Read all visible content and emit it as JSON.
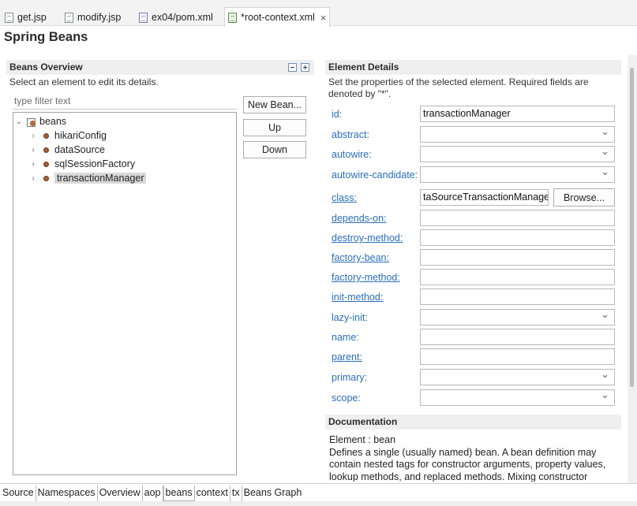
{
  "editor_tabs": [
    {
      "label": "get.jsp",
      "icon": "jsp-file-icon"
    },
    {
      "label": "modify.jsp",
      "icon": "jsp-file-icon"
    },
    {
      "label": "ex04/pom.xml",
      "icon": "xml-file-icon"
    },
    {
      "label": "*root-context.xml",
      "icon": "spring-config-file-icon",
      "active": true,
      "close": "×"
    }
  ],
  "page_title": "Spring Beans",
  "beans_overview": {
    "title": "Beans Overview",
    "description": "Select an element to edit its details.",
    "filter_placeholder": "type filter text",
    "tree": {
      "root": "beans",
      "children": [
        "hikariConfig",
        "dataSource",
        "sqlSessionFactory",
        "transactionManager"
      ],
      "selected": "transactionManager"
    },
    "buttons": {
      "new_bean": "New Bean...",
      "up": "Up",
      "down": "Down"
    }
  },
  "element_details": {
    "title": "Element Details",
    "description": "Set the properties of the selected element. Required fields are denoted by \"*\".",
    "fields": [
      {
        "label": "id:",
        "value": "transactionManager",
        "type": "text",
        "link": false
      },
      {
        "label": "abstract:",
        "value": "",
        "type": "combo",
        "link": false
      },
      {
        "label": "autowire:",
        "value": "",
        "type": "combo",
        "link": false
      },
      {
        "label": "autowire-candidate:",
        "value": "",
        "type": "combo",
        "link": false
      },
      {
        "label": "class:",
        "value": "taSourceTransactionManager",
        "type": "text",
        "link": true
      },
      {
        "label": "depends-on:",
        "value": "",
        "type": "text",
        "link": true
      },
      {
        "label": "destroy-method:",
        "value": "",
        "type": "text",
        "link": true
      },
      {
        "label": "factory-bean:",
        "value": "",
        "type": "text",
        "link": true
      },
      {
        "label": "factory-method:",
        "value": "",
        "type": "text",
        "link": true
      },
      {
        "label": "init-method:",
        "value": "",
        "type": "text",
        "link": true
      },
      {
        "label": "lazy-init:",
        "value": "",
        "type": "combo",
        "link": false
      },
      {
        "label": "name:",
        "value": "",
        "type": "text",
        "link": false
      },
      {
        "label": "parent:",
        "value": "",
        "type": "text",
        "link": true
      },
      {
        "label": "primary:",
        "value": "",
        "type": "combo",
        "link": false
      },
      {
        "label": "scope:",
        "value": "",
        "type": "combo",
        "link": false
      }
    ],
    "browse_label": "Browse..."
  },
  "documentation": {
    "title": "Documentation",
    "text": "Element : bean\nDefines a single (usually named) bean. A bean definition may contain nested tags for constructor arguments, property values, lookup methods, and replaced methods. Mixing constructor"
  },
  "bottom_tabs": [
    "Source",
    "Namespaces",
    "Overview",
    "aop",
    "beans",
    "context",
    "tx",
    "Beans Graph"
  ],
  "bottom_tabs_active": "beans",
  "colors": {
    "link": "#2a6ebb",
    "section_header_bg": "#efefef",
    "selection_bg": "#d9d9d9"
  }
}
